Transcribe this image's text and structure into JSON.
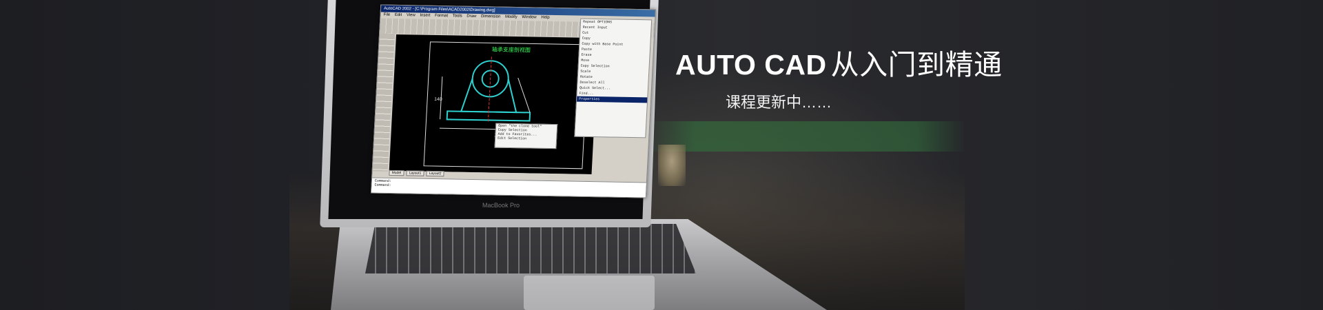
{
  "banner": {
    "title_en": "AUTO CAD",
    "title_cn": "从入门到精通",
    "subtitle": "课程更新中……"
  },
  "laptop": {
    "brand": "MacBook Pro"
  },
  "cad": {
    "titlebar": "AutoCAD 2002 - [C:\\Program Files\\ACAD2002\\Drawing.dwg]",
    "menu": [
      "File",
      "Edit",
      "View",
      "Insert",
      "Format",
      "Tools",
      "Draw",
      "Dimension",
      "Modify",
      "Window",
      "Help"
    ],
    "drawing_title": "轴承支座剖视图",
    "context_menu": [
      "Repeat OPTIONS",
      "Recent Input",
      "Cut",
      "Copy",
      "Copy with Base Point",
      "Paste",
      "Erase",
      "Move",
      "Copy Selection",
      "Scale",
      "Rotate",
      "Deselect All",
      "Quick Select...",
      "Find...",
      "Properties"
    ],
    "context_menu_highlight": "Properties",
    "popup_menu": [
      "Open \"the clone tool\"",
      "Copy Selection",
      "Add to Favorites...",
      "Edit Selection"
    ],
    "tabs": [
      "Model",
      "Layout1",
      "Layout2"
    ],
    "command_lines": [
      "Command:",
      "Command:"
    ]
  },
  "colors": {
    "accent_green": "#39ff5a",
    "banner_bg": "#1f2023",
    "text": "#ffffff"
  }
}
